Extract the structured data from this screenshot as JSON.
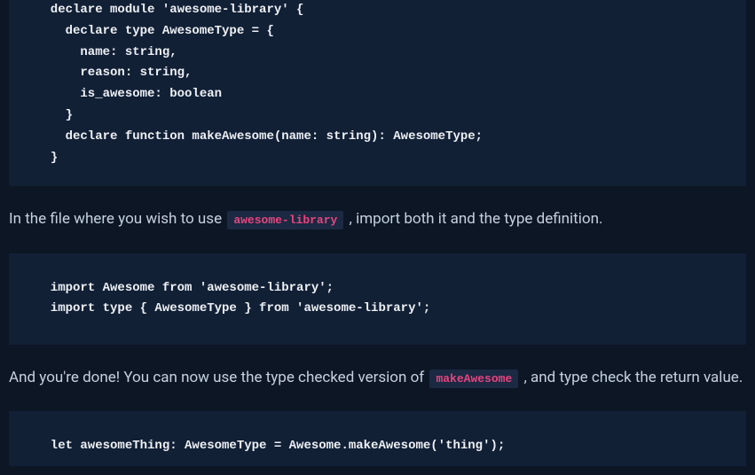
{
  "code_block_1": "  declare module 'awesome-library' {\n    declare type AwesomeType = {\n      name: string,\n      reason: string,\n      is_awesome: boolean\n    }\n    declare function makeAwesome(name: string): AwesomeType;\n  }",
  "paragraph_1_a": "In the file where you wish to use ",
  "inline_code_1": "awesome-library",
  "paragraph_1_b": " , import both it and the type definition.",
  "code_block_2": "  import Awesome from 'awesome-library';\n  import type { AwesomeType } from 'awesome-library';",
  "paragraph_2_a": "And you're done! You can now use the type checked version of ",
  "inline_code_2": "makeAwesome",
  "paragraph_2_b": " , and type check the return value.",
  "code_block_3": "  let awesomeThing: AwesomeType = Awesome.makeAwesome('thing');"
}
